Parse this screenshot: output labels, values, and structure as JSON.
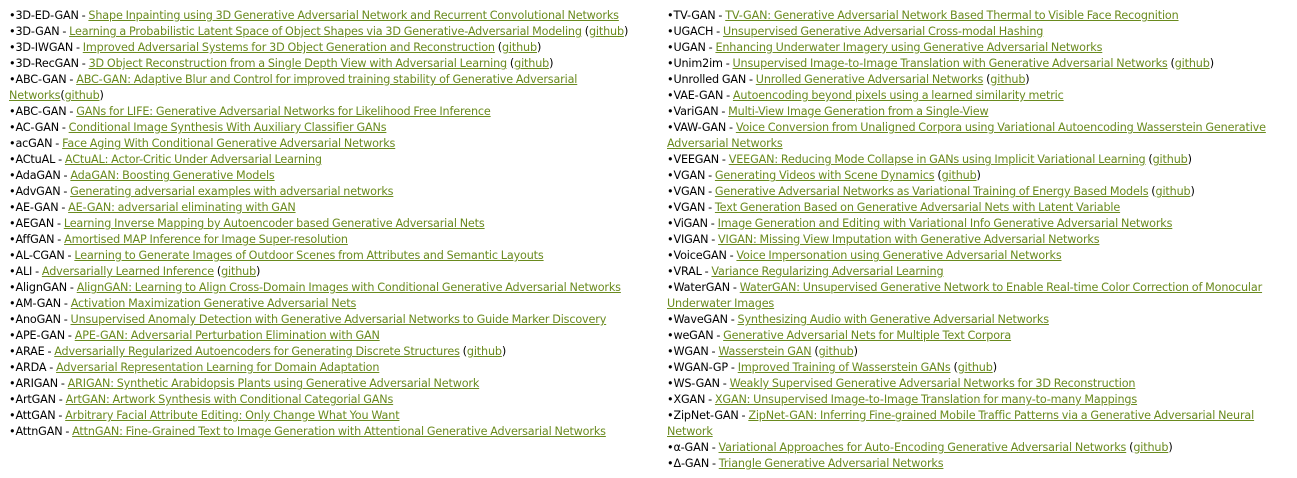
{
  "link_color": "#6a8a1e",
  "left": [
    {
      "name": "3D-ED-GAN",
      "title": "Shape Inpainting using 3D Generative Adversarial Network and Recurrent Convolutional Networks",
      "github": false
    },
    {
      "name": "3D-GAN",
      "title": "Learning a Probabilistic Latent Space of Object Shapes via 3D Generative-Adversarial Modeling",
      "github": true
    },
    {
      "name": "3D-IWGAN",
      "title": "Improved Adversarial Systems for 3D Object Generation and Reconstruction",
      "github": true
    },
    {
      "name": "3D-RecGAN",
      "title": "3D Object Reconstruction from a Single Depth View with Adversarial Learning",
      "github": true
    },
    {
      "name": "ABC-GAN",
      "title": "ABC-GAN: Adaptive Blur and Control for improved training stability of Generative Adversarial Networks",
      "github": true,
      "tight": true
    },
    {
      "name": "ABC-GAN",
      "title": "GANs for LIFE: Generative Adversarial Networks for Likelihood Free Inference",
      "github": false
    },
    {
      "name": "AC-GAN",
      "title": "Conditional Image Synthesis With Auxiliary Classifier GANs",
      "github": false
    },
    {
      "name": "acGAN",
      "title": "Face Aging With Conditional Generative Adversarial Networks",
      "github": false
    },
    {
      "name": "ACtuAL",
      "title": "ACtuAL: Actor-Critic Under Adversarial Learning",
      "github": false
    },
    {
      "name": "AdaGAN",
      "title": "AdaGAN: Boosting Generative Models",
      "github": false
    },
    {
      "name": "AdvGAN",
      "title": "Generating adversarial examples with adversarial networks",
      "github": false
    },
    {
      "name": "AE-GAN",
      "title": "AE-GAN: adversarial eliminating with GAN",
      "github": false
    },
    {
      "name": "AEGAN",
      "title": "Learning Inverse Mapping by Autoencoder based Generative Adversarial Nets",
      "github": false
    },
    {
      "name": "AffGAN",
      "title": "Amortised MAP Inference for Image Super-resolution",
      "github": false
    },
    {
      "name": "AL-CGAN",
      "title": "Learning to Generate Images of Outdoor Scenes from Attributes and Semantic Layouts",
      "github": false
    },
    {
      "name": "ALI",
      "title": "Adversarially Learned Inference",
      "github": true
    },
    {
      "name": "AlignGAN",
      "title": "AlignGAN: Learning to Align Cross-Domain Images with Conditional Generative Adversarial Networks",
      "github": false
    },
    {
      "name": "AM-GAN",
      "title": "Activation Maximization Generative Adversarial Nets",
      "github": false
    },
    {
      "name": "AnoGAN",
      "title": "Unsupervised Anomaly Detection with Generative Adversarial Networks to Guide Marker Discovery",
      "github": false
    },
    {
      "name": "APE-GAN",
      "title": "APE-GAN: Adversarial Perturbation Elimination with GAN",
      "github": false
    },
    {
      "name": "ARAE",
      "title": "Adversarially Regularized Autoencoders for Generating Discrete Structures",
      "github": true
    },
    {
      "name": "ARDA",
      "title": "Adversarial Representation Learning for Domain Adaptation",
      "github": false
    },
    {
      "name": "ARIGAN",
      "title": "ARIGAN: Synthetic Arabidopsis Plants using Generative Adversarial Network",
      "github": false
    },
    {
      "name": "ArtGAN",
      "title": "ArtGAN: Artwork Synthesis with Conditional Categorial GANs",
      "github": false
    },
    {
      "name": "AttGAN",
      "title": "Arbitrary Facial Attribute Editing: Only Change What You Want",
      "github": false
    },
    {
      "name": "AttnGAN",
      "title": "AttnGAN: Fine-Grained Text to Image Generation with Attentional Generative Adversarial Networks",
      "github": false
    }
  ],
  "right": [
    {
      "name": "TV-GAN",
      "title": "TV-GAN: Generative Adversarial Network Based Thermal to Visible Face Recognition",
      "github": false
    },
    {
      "name": "UGACH",
      "title": "Unsupervised Generative Adversarial Cross-modal Hashing",
      "github": false
    },
    {
      "name": "UGAN",
      "title": "Enhancing Underwater Imagery using Generative Adversarial Networks",
      "github": false
    },
    {
      "name": "Unim2im",
      "title": "Unsupervised Image-to-Image Translation with Generative Adversarial Networks",
      "github": true
    },
    {
      "name": "Unrolled GAN",
      "title": "Unrolled Generative Adversarial Networks",
      "github": true
    },
    {
      "name": "VAE-GAN",
      "title": "Autoencoding beyond pixels using a learned similarity metric",
      "github": false
    },
    {
      "name": "VariGAN",
      "title": "Multi-View Image Generation from a Single-View",
      "github": false
    },
    {
      "name": "VAW-GAN",
      "title": "Voice Conversion from Unaligned Corpora using Variational Autoencoding Wasserstein Generative Adversarial Networks",
      "github": false
    },
    {
      "name": "VEEGAN",
      "title": "VEEGAN: Reducing Mode Collapse in GANs using Implicit Variational Learning",
      "github": true
    },
    {
      "name": "VGAN",
      "title": "Generating Videos with Scene Dynamics",
      "github": true
    },
    {
      "name": "VGAN",
      "title": "Generative Adversarial Networks as Variational Training of Energy Based Models",
      "github": true
    },
    {
      "name": "VGAN",
      "title": "Text Generation Based on Generative Adversarial Nets with Latent Variable",
      "github": false
    },
    {
      "name": "ViGAN",
      "title": "Image Generation and Editing with Variational Info Generative Adversarial Networks",
      "github": false
    },
    {
      "name": "VIGAN",
      "title": "VIGAN: Missing View Imputation with Generative Adversarial Networks",
      "github": false
    },
    {
      "name": "VoiceGAN",
      "title": "Voice Impersonation using Generative Adversarial Networks",
      "github": false
    },
    {
      "name": "VRAL",
      "title": "Variance Regularizing Adversarial Learning",
      "github": false
    },
    {
      "name": "WaterGAN",
      "title": "WaterGAN: Unsupervised Generative Network to Enable Real-time Color Correction of Monocular Underwater Images",
      "github": false
    },
    {
      "name": "WaveGAN",
      "title": "Synthesizing Audio with Generative Adversarial Networks",
      "github": false
    },
    {
      "name": "weGAN",
      "title": "Generative Adversarial Nets for Multiple Text Corpora",
      "github": false
    },
    {
      "name": "WGAN",
      "title": "Wasserstein GAN",
      "github": true
    },
    {
      "name": "WGAN-GP",
      "title": "Improved Training of Wasserstein GANs",
      "github": true
    },
    {
      "name": "WS-GAN",
      "title": "Weakly Supervised Generative Adversarial Networks for 3D Reconstruction",
      "github": false
    },
    {
      "name": "XGAN",
      "title": "XGAN: Unsupervised Image-to-Image Translation for many-to-many Mappings",
      "github": false
    },
    {
      "name": "ZipNet-GAN",
      "title": "ZipNet-GAN: Inferring Fine-grained Mobile Traffic Patterns via a Generative Adversarial Neural Network",
      "github": false
    },
    {
      "name": "α-GAN",
      "title": "Variational Approaches for Auto-Encoding Generative Adversarial Networks",
      "github": true
    },
    {
      "name": "Δ-GAN",
      "title": "Triangle Generative Adversarial Networks",
      "github": false
    }
  ],
  "labels": {
    "bullet": "•",
    "sep": " - ",
    "github": "github",
    "open": "(",
    "close": ")"
  }
}
